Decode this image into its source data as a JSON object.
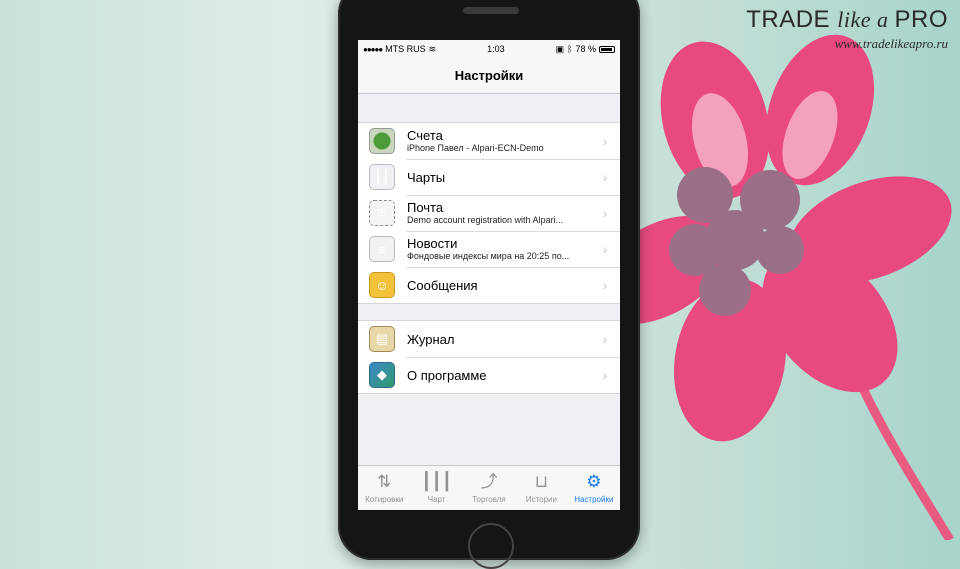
{
  "brand": {
    "title_part1": "TRADE ",
    "title_part2": "like a ",
    "title_part3": "PRO",
    "url": "www.tradelikeapro.ru"
  },
  "status_bar": {
    "carrier": "MTS RUS",
    "time": "1:03",
    "battery": "78 %"
  },
  "navbar": {
    "title": "Настройки"
  },
  "settings": {
    "group1": [
      {
        "title": "Счета",
        "subtitle": "iPhone Павел - Alpari-ECN-Demo",
        "icon": "accounts-icon"
      },
      {
        "title": "Чарты",
        "icon": "candlestick-icon"
      },
      {
        "title": "Почта",
        "subtitle": "Demo account registration with Alpari...",
        "icon": "mail-icon"
      },
      {
        "title": "Новости",
        "subtitle": "Фондовые индексы мира на 20:25 по...",
        "icon": "news-icon"
      },
      {
        "title": "Сообщения",
        "icon": "messages-icon"
      }
    ],
    "group2": [
      {
        "title": "Журнал",
        "icon": "journal-icon"
      },
      {
        "title": "О программе",
        "icon": "about-icon"
      }
    ]
  },
  "tabbar": [
    {
      "label": "Котировки",
      "icon": "quotes-icon"
    },
    {
      "label": "Чарт",
      "icon": "chart-icon"
    },
    {
      "label": "Торговля",
      "icon": "trade-icon"
    },
    {
      "label": "Истории",
      "icon": "history-icon"
    },
    {
      "label": "Настройки",
      "icon": "settings-gear-icon",
      "active": true
    }
  ],
  "colors": {
    "accent": "#1a7cf1",
    "flower": "#e84a7f"
  }
}
